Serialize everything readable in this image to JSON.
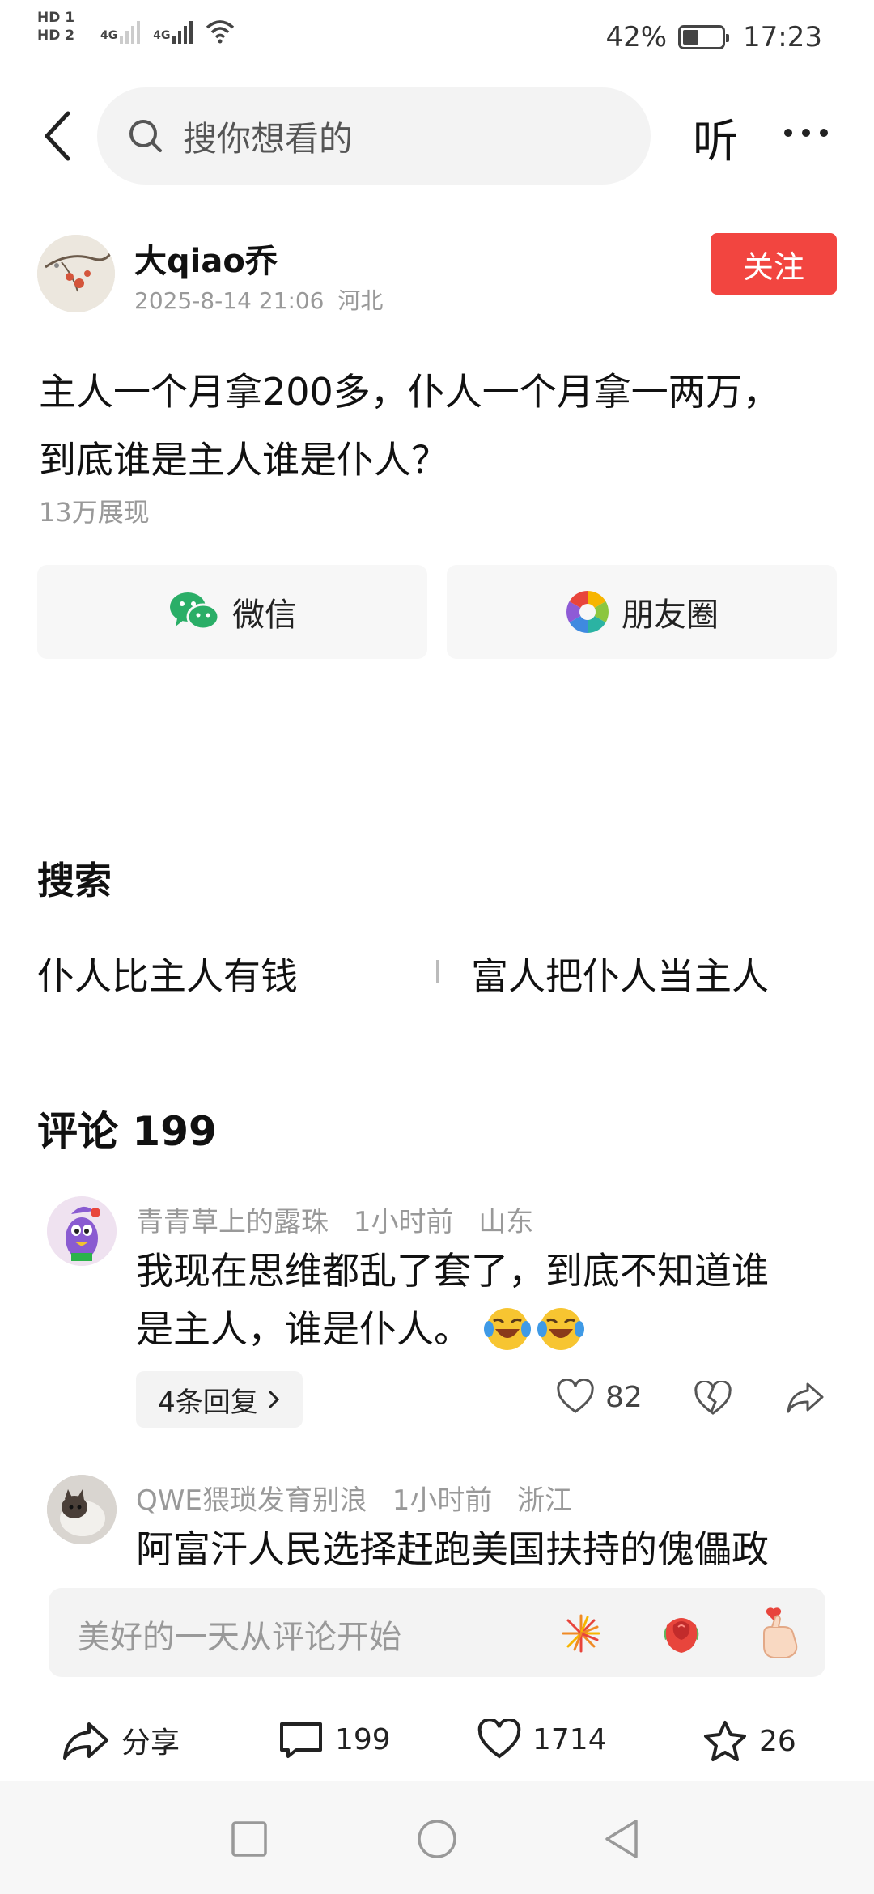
{
  "status_bar": {
    "hd1": "HD 1",
    "hd2": "HD 2",
    "net1": "4G",
    "net2": "4G",
    "battery_percent": "42%",
    "battery_level": 0.42,
    "time": "17:23"
  },
  "top_bar": {
    "search_placeholder": "搜你想看的",
    "listen_label": "听"
  },
  "post": {
    "author_name": "大qiao乔",
    "timestamp": "2025-8-14 21:06",
    "location": "河北",
    "follow_label": "关注",
    "title_line1": "主人一个月拿200多，仆人一个月拿一两万，",
    "title_line2": "到底谁是主人谁是仆人？",
    "views": "13万展现"
  },
  "share_targets": {
    "wechat_label": "微信",
    "moments_label": "朋友圈"
  },
  "search_section": {
    "heading": "搜索",
    "keywords": [
      "仆人比主人有钱",
      "富人把仆人当主人"
    ]
  },
  "comments_section": {
    "heading": "评论 199",
    "comments": [
      {
        "user": "青青草上的露珠",
        "time": "1小时前",
        "location": "山东",
        "text_line1": "我现在思维都乱了套了，到底不知道谁",
        "text_line2": "是主人，谁是仆人。",
        "replies_label": "4条回复",
        "likes": "82"
      },
      {
        "user": "QWE猥琐发育别浪",
        "time": "1小时前",
        "location": "浙江",
        "text_line1": "阿富汗人民选择赶跑美国扶持的傀儡政"
      }
    ]
  },
  "comment_input": {
    "placeholder": "美好的一天从评论开始"
  },
  "bottom_actions": {
    "share_label": "分享",
    "comments_count": "199",
    "likes_count": "1714",
    "favorites_count": "26"
  },
  "colors": {
    "accent": "#f24540",
    "muted_text": "#999999",
    "background": "#ffffff"
  }
}
